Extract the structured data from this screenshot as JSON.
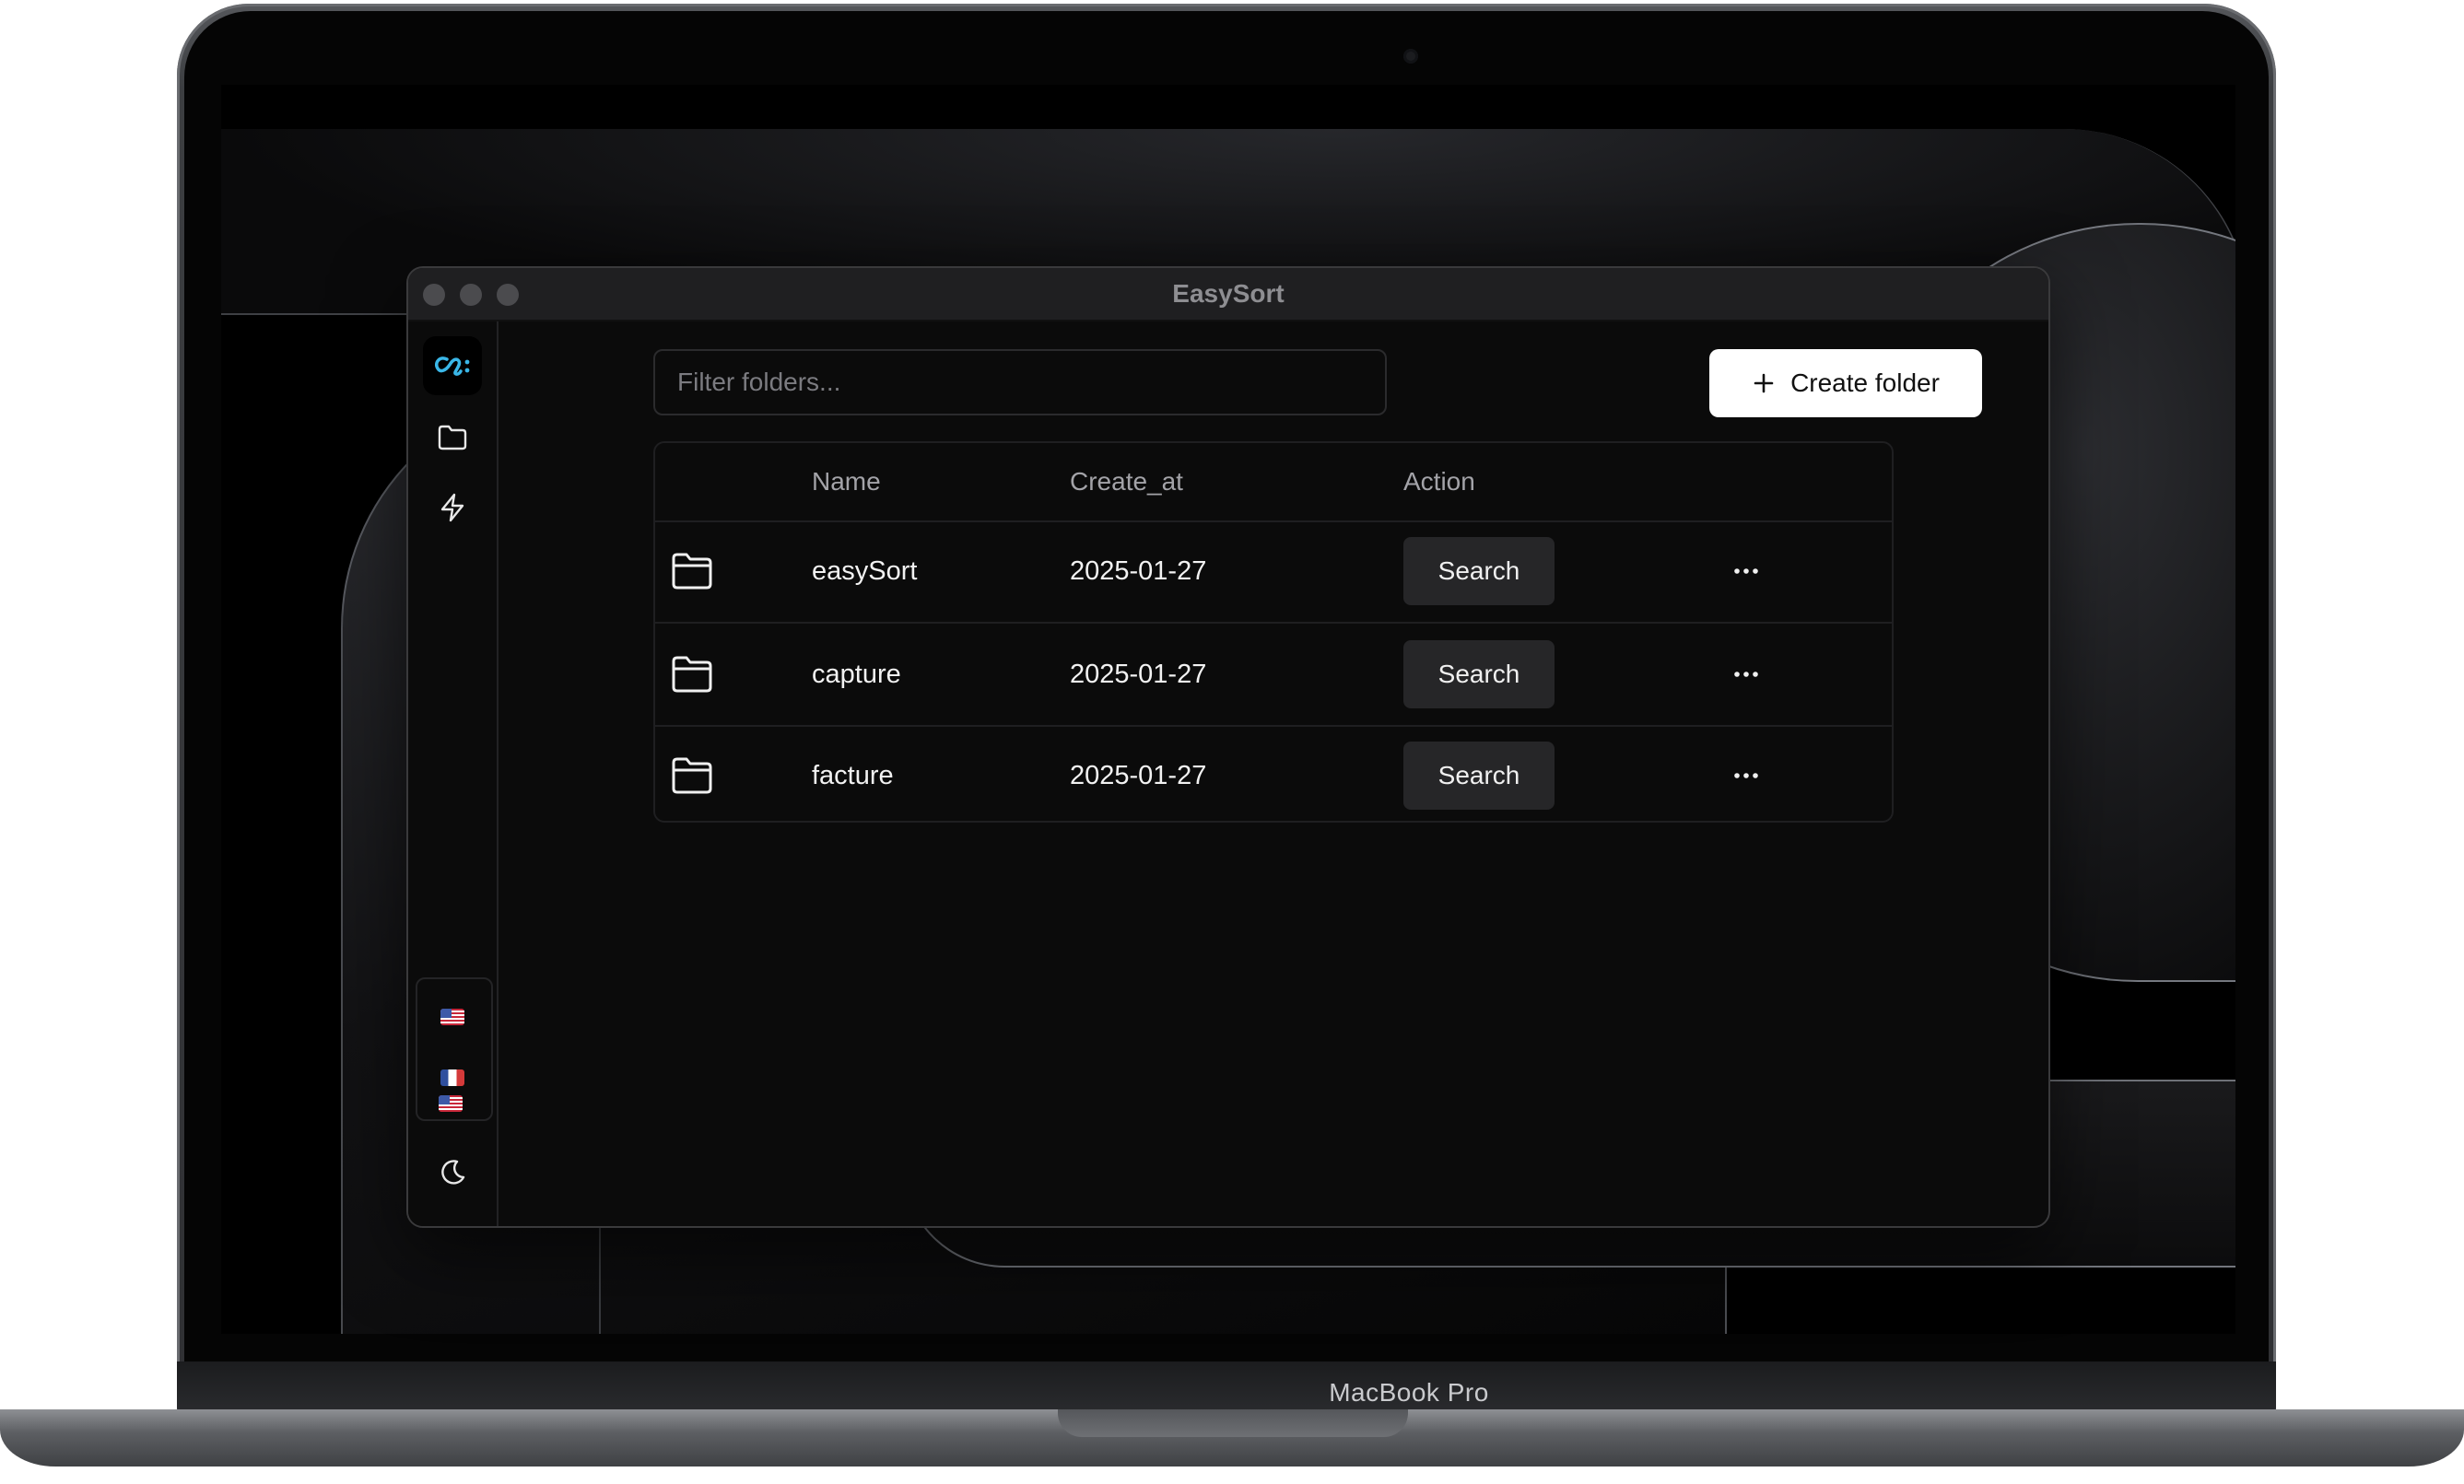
{
  "device": {
    "label": "MacBook Pro"
  },
  "window": {
    "title": "EasySort"
  },
  "sidebar": {
    "logo_icon": "easysort-logo-icon",
    "nav_items": [
      {
        "icon": "folder-icon"
      },
      {
        "icon": "lightning-icon"
      }
    ],
    "languages": [
      {
        "flag": "us-flag"
      },
      {
        "flag": "fr-flag"
      },
      {
        "flag": "us-flag"
      }
    ],
    "theme_icon": "moon-icon"
  },
  "toolbar": {
    "filter_placeholder": "Filter folders...",
    "create_label": "Create folder",
    "create_icon": "plus-icon"
  },
  "table": {
    "columns": [
      "Name",
      "Create_at",
      "Action"
    ],
    "rows": [
      {
        "icon": "folder-icon",
        "name": "easySort",
        "created_at": "2025-01-27",
        "action": "Search"
      },
      {
        "icon": "folder-icon",
        "name": "capture",
        "created_at": "2025-01-27",
        "action": "Search"
      },
      {
        "icon": "folder-icon",
        "name": "facture",
        "created_at": "2025-01-27",
        "action": "Search"
      }
    ]
  },
  "colors": {
    "accent": "#3ab7e8",
    "background": "#0b0b0b",
    "primary_button": "#ffffff",
    "secondary_button": "#262628"
  }
}
